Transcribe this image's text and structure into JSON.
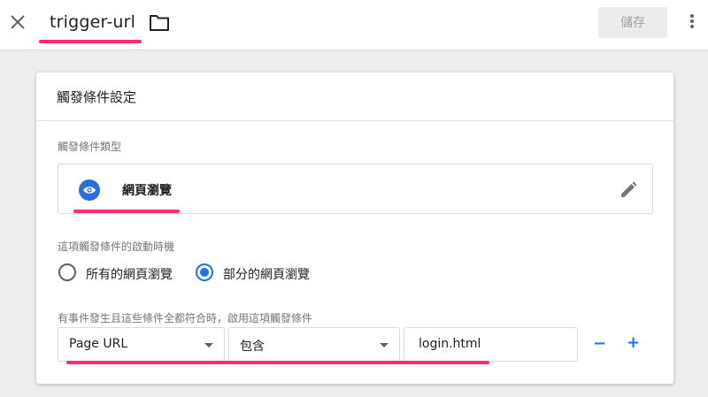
{
  "topbar": {
    "title": "trigger-url",
    "save_label": "儲存"
  },
  "card": {
    "title": "觸發條件設定",
    "type_section": {
      "label": "觸發條件類型",
      "selected_type": "網頁瀏覽"
    },
    "fire_section": {
      "label": "這項觸發條件的啟動時機",
      "options": [
        {
          "label": "所有的網頁瀏覽",
          "checked": false
        },
        {
          "label": "部分的網頁瀏覽",
          "checked": true
        }
      ]
    },
    "condition_section": {
      "label": "有事件發生且這些條件全都符合時，啟用這項觸發條件",
      "variable": "Page URL",
      "operator": "包含",
      "value": "login.html",
      "remove_label": "−",
      "add_label": "+"
    }
  },
  "colors": {
    "accent": "#1a73e8",
    "highlight": "#ff2d6f"
  },
  "icons": [
    "close-icon",
    "folder-icon",
    "more-vert-icon",
    "eye-icon",
    "pencil-icon"
  ]
}
